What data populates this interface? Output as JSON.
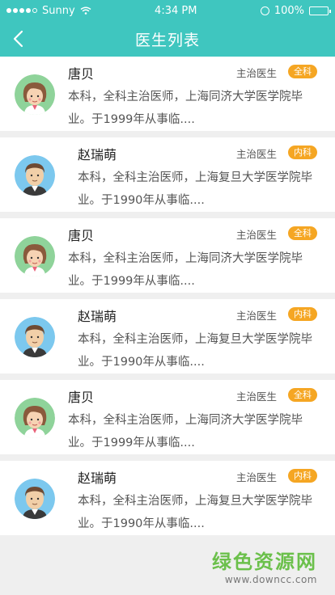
{
  "status_bar": {
    "carrier": "Sunny",
    "time": "4:34 PM",
    "battery": "100%"
  },
  "nav": {
    "title": "医生列表"
  },
  "doctors": [
    {
      "name": "唐贝",
      "role": "主治医生",
      "dept": "全科",
      "desc": "本科，全科主治医师，上海同济大学医学院毕业。于1999年从事临....",
      "avatar": "female-doctor"
    },
    {
      "name": "赵瑞萌",
      "role": "主治医生",
      "dept": "内科",
      "desc": "本科，全科主治医师，上海复旦大学医学院毕业。于1990年从事临....",
      "avatar": "male-doctor"
    },
    {
      "name": "唐贝",
      "role": "主治医生",
      "dept": "全科",
      "desc": "本科，全科主治医师，上海同济大学医学院毕业。于1999年从事临....",
      "avatar": "female-doctor"
    },
    {
      "name": "赵瑞萌",
      "role": "主治医生",
      "dept": "内科",
      "desc": "本科，全科主治医师，上海复旦大学医学院毕业。于1990年从事临....",
      "avatar": "male-doctor"
    },
    {
      "name": "唐贝",
      "role": "主治医生",
      "dept": "全科",
      "desc": "本科，全科主治医师，上海同济大学医学院毕业。于1999年从事临....",
      "avatar": "female-doctor"
    },
    {
      "name": "赵瑞萌",
      "role": "主治医生",
      "dept": "内科",
      "desc": "本科，全科主治医师，上海复旦大学医学院毕业。于1990年从事临....",
      "avatar": "male-doctor"
    }
  ],
  "watermark": {
    "text": "绿色资源网",
    "url": "www.downcc.com"
  },
  "colors": {
    "header": "#3fc6bf",
    "badge": "#f5a623",
    "female_avatar_bg": "#8fd39a",
    "male_avatar_bg": "#7cc8ee"
  }
}
